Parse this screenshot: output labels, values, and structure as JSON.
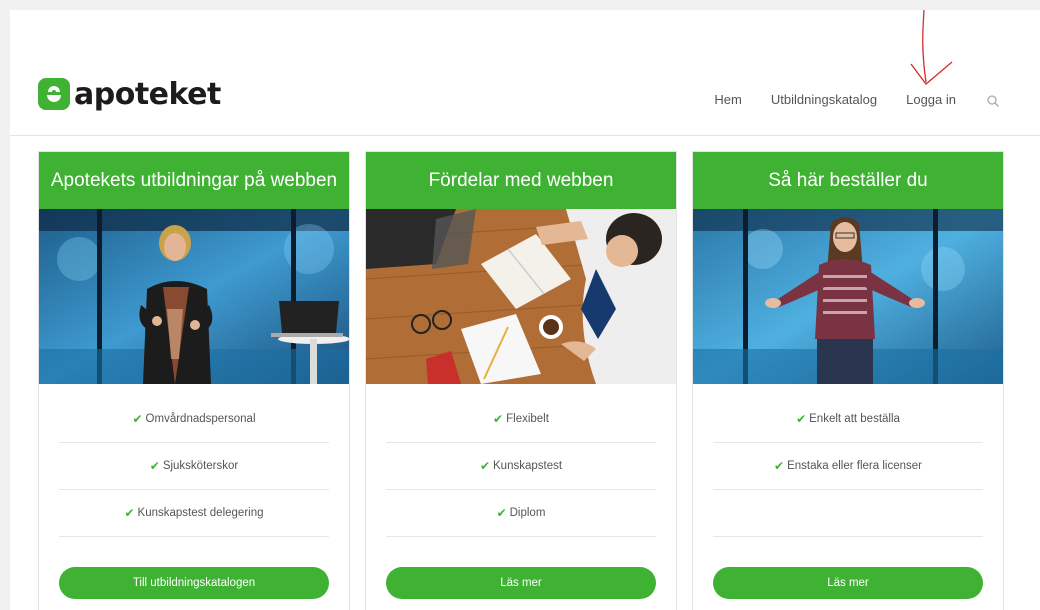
{
  "brand": {
    "name": "apoteket",
    "color": "#3fb233"
  },
  "nav": {
    "items": [
      "Hem",
      "Utbildningskatalog",
      "Logga in"
    ],
    "search_icon": "search-icon"
  },
  "cards": [
    {
      "title": "Apotekets utbildningar på webben",
      "image": "presenter-woman-with-laptop-photo",
      "features": [
        "Omvårdnadspersonal",
        "Sjuksköterskor",
        "Kunskapstest delegering"
      ],
      "button": "Till utbildningskatalogen"
    },
    {
      "title": "Fördelar med webben",
      "image": "man-reading-book-at-desk-photo",
      "features": [
        "Flexibelt",
        "Kunskapstest",
        "Diplom"
      ],
      "button": "Läs mer"
    },
    {
      "title": "Så här beställer du",
      "image": "presenter-woman-gesturing-photo",
      "features": [
        "Enkelt att beställa",
        "Enstaka eller flera licenser",
        ""
      ],
      "button": "Läs mer"
    }
  ],
  "check_icon": "check-icon"
}
